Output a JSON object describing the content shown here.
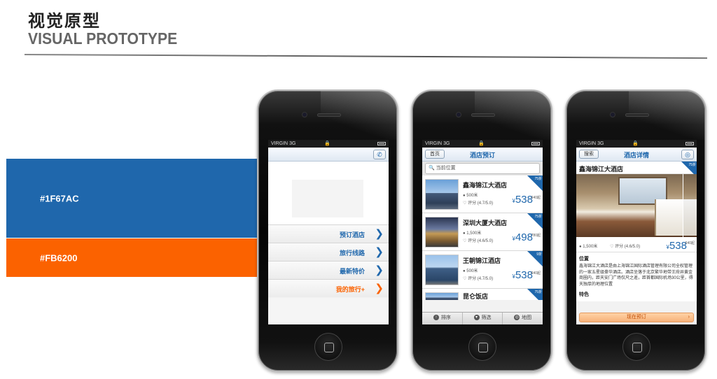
{
  "header": {
    "title": "视觉原型",
    "subtitle": "VISUAL PROTOTYPE"
  },
  "swatches": [
    {
      "label": "#1F67AC",
      "color": "#1F67AC"
    },
    {
      "label": "#FB6200",
      "color": "#FB6200"
    }
  ],
  "status_bar": {
    "carrier": "VIRGIN",
    "network": "3G",
    "lock_glyph": "🔒"
  },
  "phone1": {
    "call_icon": "phone-icon",
    "menu": [
      {
        "label": "预订酒店",
        "accent": "blue"
      },
      {
        "label": "旅行线路",
        "accent": "blue"
      },
      {
        "label": "最新特价",
        "accent": "blue"
      },
      {
        "label": "我的旅行+",
        "accent": "orange"
      }
    ]
  },
  "phone2": {
    "back_label": "首页",
    "title": "酒店预订",
    "search_placeholder": "当前位置",
    "hotels": [
      {
        "name": "鑫海锦江大酒店",
        "distance": "500米",
        "score": "评分 (4.7/5.0)",
        "price": "538",
        "suffix": "640起",
        "badge": "75折"
      },
      {
        "name": "深圳大厦大酒店",
        "distance": "1,500米",
        "score": "评分 (4.6/5.0)",
        "price": "498",
        "suffix": "780起",
        "badge": "75折"
      },
      {
        "name": "王朝锦江酒店",
        "distance": "500米",
        "score": "评分 (4.7/5.0)",
        "price": "538",
        "suffix": "640起",
        "badge": "9折"
      },
      {
        "name": "昆仑饭店",
        "badge": "75折"
      }
    ],
    "tabs": [
      {
        "label": "排序",
        "icon": "sort-icon"
      },
      {
        "label": "筛选",
        "icon": "filter-icon"
      },
      {
        "label": "地图",
        "icon": "globe-icon"
      }
    ]
  },
  "phone3": {
    "back_label": "搜索",
    "title": "酒店详情",
    "nav_icon": "globe-icon",
    "hotel_name": "鑫海锦江大酒店",
    "badge": "75折",
    "distance": "1,500米",
    "score": "评分 (4.6/5.0)",
    "price": "538",
    "suffix": "640起",
    "location_heading": "位置",
    "location_text": "鑫海锦江大酒店是由上海锦江国际酒店管理有限公司全权管理的一家五星级豪华酒店。酒店坐落于北京繁华地带王府井黄金商圈内，距天安门广场仅尺之遥，距首都国际机场30公里，得天独厚的地理位置",
    "features_heading": "特色",
    "book_label": "现在预订"
  },
  "currency_symbol": "¥"
}
